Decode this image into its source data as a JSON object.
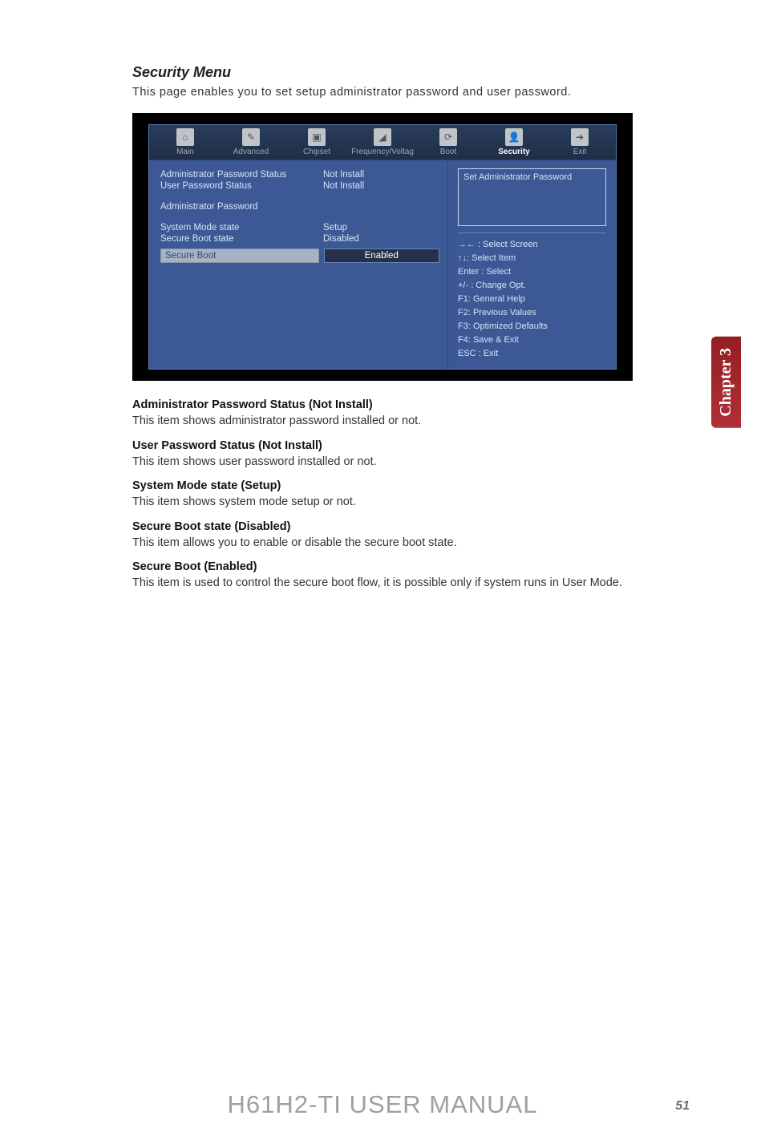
{
  "section_title": "Security Menu",
  "intro": "This page enables you to set setup administrator password and user password.",
  "bios": {
    "tabs": [
      "Main",
      "Advanced",
      "Chipset",
      "Frequency/Voltag",
      "Boot",
      "Security",
      "Exit"
    ],
    "active_tab": "Security",
    "rows": {
      "admin_pw_status_label": "Administrator Password Status",
      "admin_pw_status_value": "Not Install",
      "user_pw_status_label": "User Password Status",
      "user_pw_status_value": "Not Install",
      "admin_password_label": "Administrator  Password",
      "system_mode_label": "System Mode state",
      "system_mode_value": "Setup",
      "secure_boot_state_label": "Secure Boot state",
      "secure_boot_state_value": "Disabled",
      "secure_boot_label": "Secure Boot",
      "secure_boot_value": "Enabled"
    },
    "help_text": "Set Administrator Password",
    "keys": {
      "k1": "→← : Select Screen",
      "k2": "↑↓: Select Item",
      "k3": "Enter : Select",
      "k4": "+/- : Change Opt.",
      "k5": "F1: General Help",
      "k6": "F2: Previous Values",
      "k7": "F3: Optimized Defaults",
      "k8": "F4: Save & Exit",
      "k9": "ESC : Exit"
    }
  },
  "content": {
    "h1": "Administrator Password Status (Not Install)",
    "p1": "This item shows administrator password installed or not.",
    "h2": "User Password Status (Not Install)",
    "p2": "This item shows user password installed or not.",
    "h3": "System Mode state (Setup)",
    "p3": "This item shows system mode setup or not.",
    "h4": "Secure Boot state (Disabled)",
    "p4": "This item allows you to enable or disable the secure boot state.",
    "h5": "Secure Boot (Enabled)",
    "p5": "This item is used to control the secure boot flow, it is possible only if system runs in User Mode."
  },
  "chapter_tab": "Chapter 3",
  "footer": "H61H2-TI USER MANUAL",
  "page_number": "51",
  "icons": [
    "⌂",
    "✎",
    "▣",
    "◢",
    "⟳",
    "👤",
    "➔"
  ]
}
